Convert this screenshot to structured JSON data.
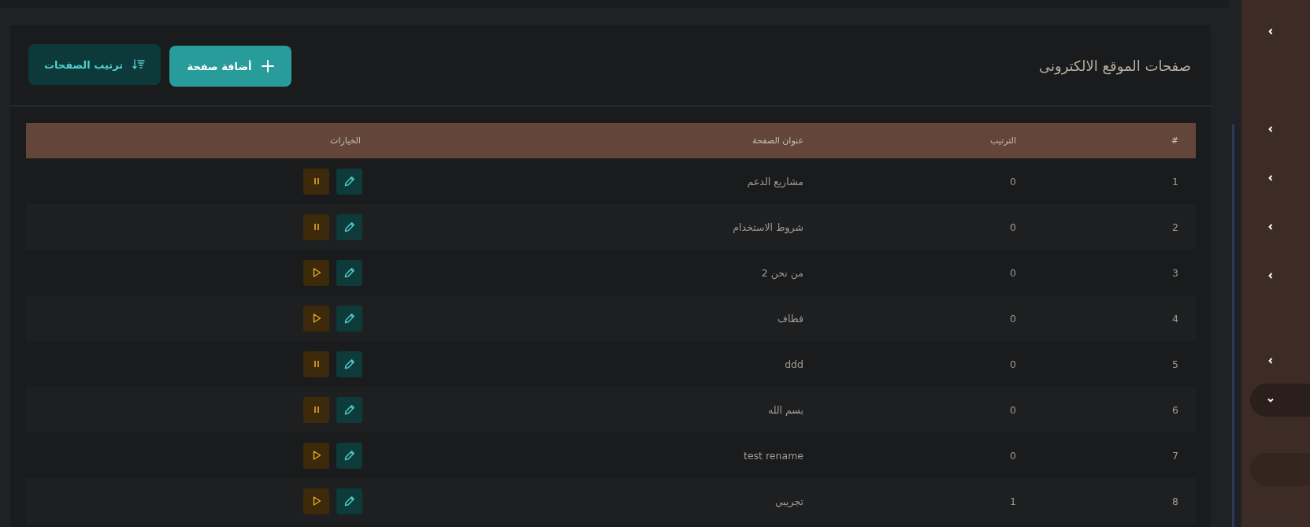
{
  "page": {
    "title": "صفحات الموقع الالكترونى"
  },
  "buttons": [
    {
      "kind": "add",
      "label": "أضافة صفحة"
    },
    {
      "kind": "sort",
      "label": "ترتيب الصفحات"
    }
  ],
  "table": {
    "columns": [
      "#",
      "الترتيب",
      "عنوان الصفحة",
      "الخيارات"
    ],
    "rows": [
      {
        "number": "1",
        "order": "0",
        "title": "مشاريع الدعم",
        "active": true
      },
      {
        "number": "2",
        "order": "0",
        "title": "شروط الاستخدام",
        "active": true
      },
      {
        "number": "3",
        "order": "0",
        "title": "من نحن 2",
        "active": false
      },
      {
        "number": "4",
        "order": "0",
        "title": "قطاف",
        "active": false
      },
      {
        "number": "5",
        "order": "0",
        "title": "ddd",
        "active": true
      },
      {
        "number": "6",
        "order": "0",
        "title": "بسم الله",
        "active": true
      },
      {
        "number": "7",
        "order": "0",
        "title": "test rename",
        "active": false
      },
      {
        "number": "8",
        "order": "1",
        "title": "تجريبي",
        "active": false
      }
    ]
  },
  "sidebar": {
    "items": [
      {
        "kind": "group",
        "expanded": false,
        "selected": false
      },
      {
        "kind": "group",
        "expanded": false,
        "selected": false
      },
      {
        "kind": "group",
        "expanded": false,
        "selected": false
      },
      {
        "kind": "group",
        "expanded": false,
        "selected": false
      },
      {
        "kind": "group",
        "expanded": false,
        "selected": false
      },
      {
        "kind": "group",
        "expanded": false,
        "selected": false
      },
      {
        "kind": "group",
        "expanded": true,
        "selected": false
      },
      {
        "kind": "link",
        "expanded": false,
        "selected": true
      }
    ]
  }
}
